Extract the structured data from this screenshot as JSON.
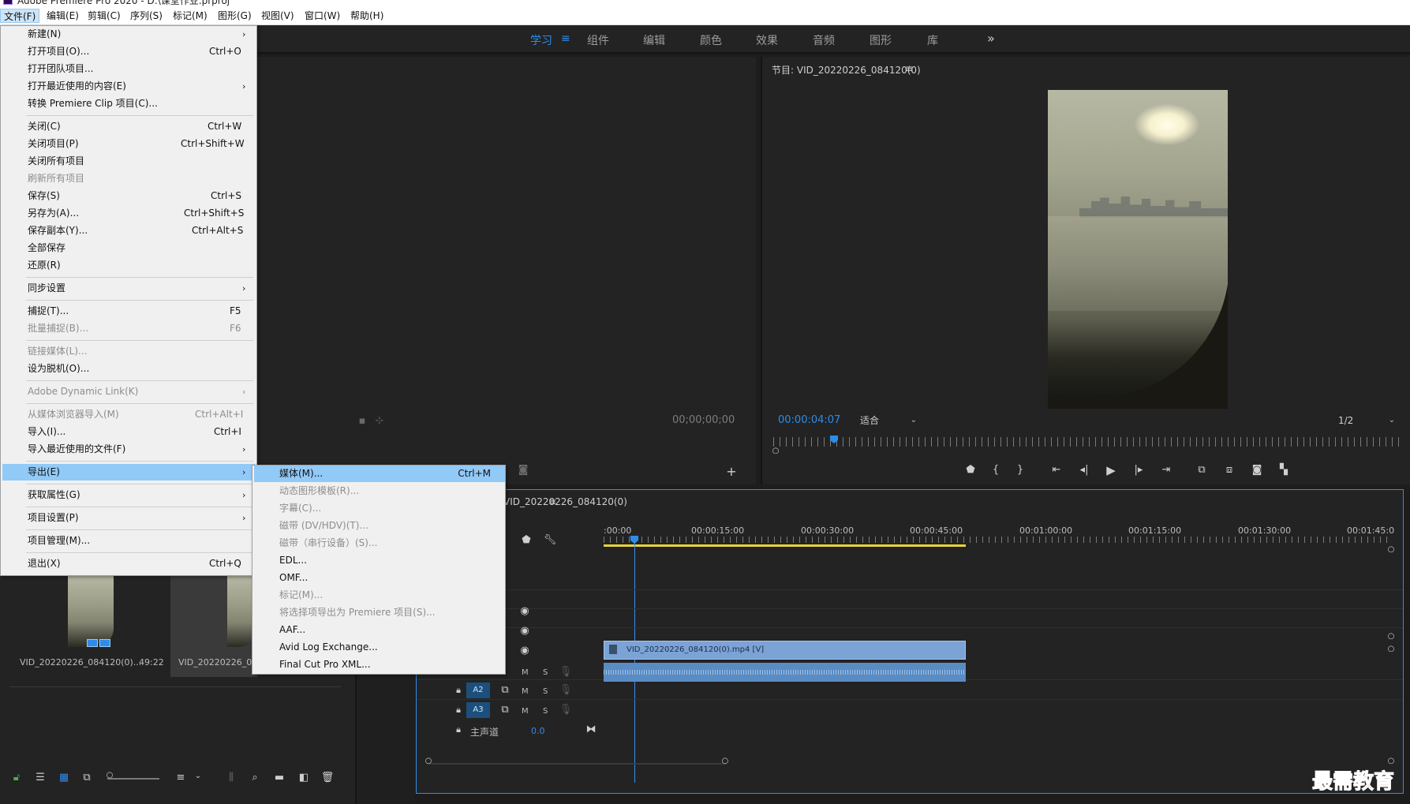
{
  "window": {
    "title": "Adobe Premiere Pro 2020 - D:\\课堂作业.prproj"
  },
  "menubar": [
    "文件(F)",
    "编辑(E)",
    "剪辑(C)",
    "序列(S)",
    "标记(M)",
    "图形(G)",
    "视图(V)",
    "窗口(W)",
    "帮助(H)"
  ],
  "workspaces": {
    "tabs": [
      "学习",
      "组件",
      "编辑",
      "颜色",
      "效果",
      "音频",
      "图形",
      "库"
    ],
    "active_index": 0
  },
  "source_monitor": {
    "timecode": "00;00;00;00"
  },
  "program_monitor": {
    "title": "节目: VID_20220226_084120(0)",
    "timecode": "00:00:04:07",
    "fit": "适合",
    "resolution": "1/2"
  },
  "project": {
    "items": [
      {
        "name": "VID_20220226_084120(0)...",
        "duration": "49:22"
      },
      {
        "name": "VID_20220226_084120(0)"
      }
    ]
  },
  "timeline": {
    "tab_title": "VID_20220226_084120(0)",
    "ruler_labels": [
      ":00:00",
      "00:00:15:00",
      "00:00:30:00",
      "00:00:45:00",
      "00:01:00:00",
      "00:01:15:00",
      "00:01:30:00",
      "00:01:45:0"
    ],
    "audio_tracks": [
      "A2",
      "A3"
    ],
    "mute_label": "M",
    "solo_label": "S",
    "master": {
      "label": "主声道",
      "value": "0.0"
    },
    "video_clip": "VID_20220226_084120(0).mp4 [V]"
  },
  "file_menu": [
    {
      "label": "新建(N)",
      "submenu": true
    },
    {
      "label": "打开项目(O)...",
      "shortcut": "Ctrl+O"
    },
    {
      "label": "打开团队项目..."
    },
    {
      "label": "打开最近使用的内容(E)",
      "submenu": true
    },
    {
      "label": "转换 Premiere Clip 项目(C)..."
    },
    {
      "label": "关闭(C)",
      "shortcut": "Ctrl+W"
    },
    {
      "label": "关闭项目(P)",
      "shortcut": "Ctrl+Shift+W"
    },
    {
      "label": "关闭所有项目"
    },
    {
      "label": "刷新所有项目",
      "disabled": true
    },
    {
      "label": "保存(S)",
      "shortcut": "Ctrl+S"
    },
    {
      "label": "另存为(A)...",
      "shortcut": "Ctrl+Shift+S"
    },
    {
      "label": "保存副本(Y)...",
      "shortcut": "Ctrl+Alt+S"
    },
    {
      "label": "全部保存"
    },
    {
      "label": "还原(R)"
    },
    {
      "label": "同步设置",
      "submenu": true
    },
    {
      "label": "捕捉(T)...",
      "shortcut": "F5"
    },
    {
      "label": "批量捕捉(B)...",
      "shortcut": "F6",
      "disabled": true
    },
    {
      "label": "链接媒体(L)...",
      "disabled": true
    },
    {
      "label": "设为脱机(O)..."
    },
    {
      "label": "Adobe Dynamic Link(K)",
      "submenu": true,
      "disabled": true
    },
    {
      "label": "从媒体浏览器导入(M)",
      "shortcut": "Ctrl+Alt+I",
      "disabled": true
    },
    {
      "label": "导入(I)...",
      "shortcut": "Ctrl+I"
    },
    {
      "label": "导入最近使用的文件(F)",
      "submenu": true
    },
    {
      "label": "导出(E)",
      "submenu": true,
      "highlighted": true
    },
    {
      "label": "获取属性(G)",
      "submenu": true
    },
    {
      "label": "项目设置(P)",
      "submenu": true
    },
    {
      "label": "项目管理(M)..."
    },
    {
      "label": "退出(X)",
      "shortcut": "Ctrl+Q"
    }
  ],
  "export_submenu": [
    {
      "label": "媒体(M)...",
      "shortcut": "Ctrl+M",
      "highlighted": true
    },
    {
      "label": "动态图形模板(R)...",
      "disabled": true
    },
    {
      "label": "字幕(C)...",
      "disabled": true
    },
    {
      "label": "磁带 (DV/HDV)(T)...",
      "disabled": true
    },
    {
      "label": "磁带（串行设备）(S)...",
      "disabled": true
    },
    {
      "label": "EDL..."
    },
    {
      "label": "OMF..."
    },
    {
      "label": "标记(M)...",
      "disabled": true
    },
    {
      "label": "将选择项导出为 Premiere 项目(S)...",
      "disabled": true
    },
    {
      "label": "AAF..."
    },
    {
      "label": "Avid Log Exchange..."
    },
    {
      "label": "Final Cut Pro XML..."
    }
  ],
  "watermark": {
    "text": "最需教育"
  },
  "colors": {
    "accent": "#2d8ceb",
    "menu_highlight": "#91c9f7",
    "clip_video": "#7ba3d6",
    "clip_audio": "#5a8cc4",
    "work_area": "#e8d43d"
  }
}
